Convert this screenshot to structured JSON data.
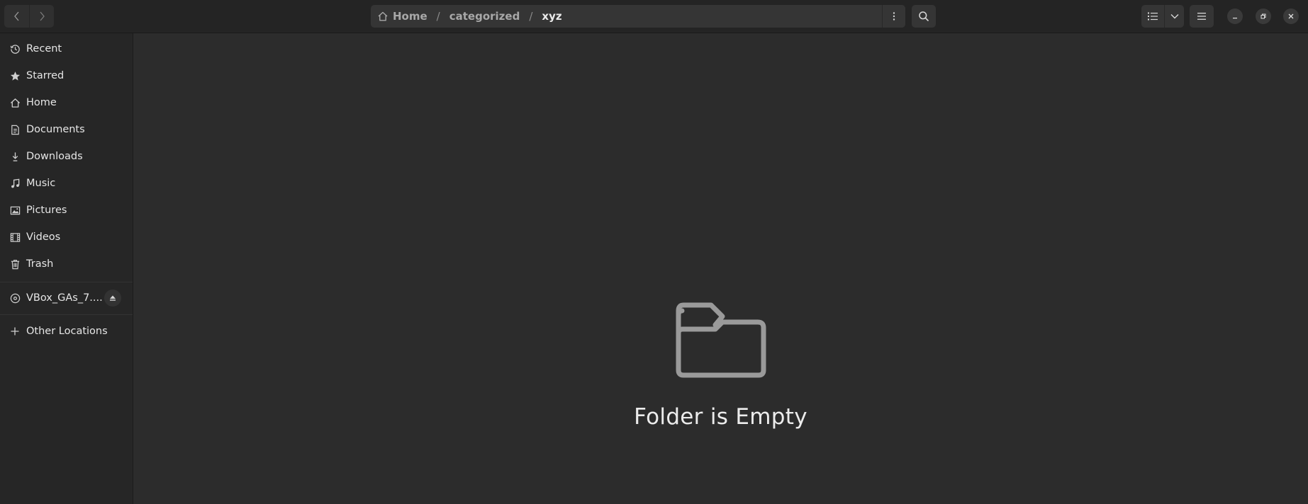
{
  "navigation": {
    "back_icon": "chevron-left-icon",
    "forward_icon": "chevron-right-icon"
  },
  "pathbar": {
    "home_icon": "home-icon",
    "segments": [
      "Home",
      "categorized",
      "xyz"
    ],
    "separator": "/",
    "menu_icon": "vertical-dots-icon"
  },
  "toolbar": {
    "search_icon": "search-icon",
    "list_view_icon": "list-view-icon",
    "view_options_icon": "chevron-down-icon",
    "main_menu_icon": "hamburger-menu-icon"
  },
  "window_controls": {
    "minimize_icon": "minimize-icon",
    "maximize_icon": "restore-icon",
    "close_icon": "close-icon"
  },
  "sidebar": {
    "items": [
      {
        "label": "Recent",
        "icon": "clock-icon"
      },
      {
        "label": "Starred",
        "icon": "star-icon"
      },
      {
        "label": "Home",
        "icon": "home-icon"
      },
      {
        "label": "Documents",
        "icon": "document-icon"
      },
      {
        "label": "Downloads",
        "icon": "download-icon"
      },
      {
        "label": "Music",
        "icon": "music-note-icon"
      },
      {
        "label": "Pictures",
        "icon": "picture-icon"
      },
      {
        "label": "Videos",
        "icon": "film-icon"
      },
      {
        "label": "Trash",
        "icon": "trash-icon"
      }
    ],
    "devices": [
      {
        "label": "VBox_GAs_7....",
        "icon": "disc-icon",
        "action_icon": "eject-icon"
      }
    ],
    "other": {
      "label": "Other Locations",
      "icon": "plus-icon"
    }
  },
  "content": {
    "empty_icon": "folder-icon",
    "empty_message": "Folder is Empty"
  },
  "colors": {
    "headerbar": "#242424",
    "sidebar": "#262626",
    "content": "#2c2c2c",
    "button": "#353535",
    "text": "#e6e6e6",
    "empty_icon": "#9a9a9a"
  }
}
